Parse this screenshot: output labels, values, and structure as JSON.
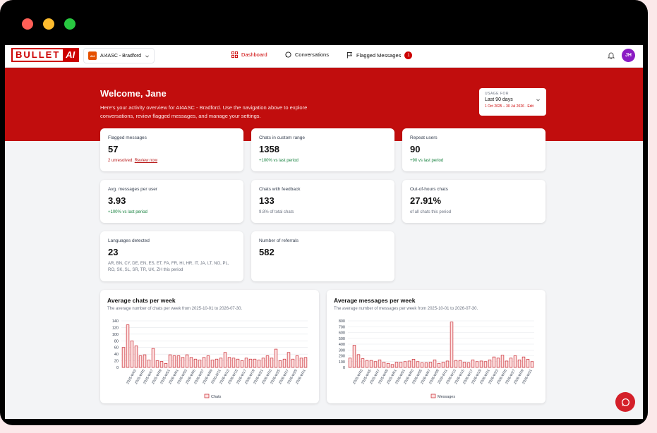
{
  "logo": {
    "part1": "BULLET",
    "part2": "AI"
  },
  "org": {
    "badge": "AI4",
    "name": "AI4ASC - Bradford"
  },
  "nav": {
    "dashboard": "Dashboard",
    "conversations": "Conversations",
    "flagged": "Flagged Messages",
    "flagged_count": "1"
  },
  "user": {
    "initials": "JH"
  },
  "hero": {
    "title": "Welcome, Jane",
    "subtitle": "Here's your activity overview for AI4ASC - Bradford. Use the navigation above to explore conversations, review flagged messages, and manage your settings."
  },
  "usage": {
    "label": "USAGE FOR",
    "value": "Last 90 days",
    "range": "1 Oct 2025 – 30 Jul 2026 · Edit"
  },
  "cards": {
    "flagged": {
      "label": "Flagged messages",
      "value": "57",
      "note_a": "2 unresolved.",
      "note_b": "Review now"
    },
    "chats": {
      "label": "Chats in custom range",
      "value": "1358",
      "note": "+100% vs last period"
    },
    "repeat": {
      "label": "Repeat users",
      "value": "90",
      "note": "+90 vs last period"
    },
    "avg": {
      "label": "Avg. messages per user",
      "value": "3.93",
      "note": "+100% vs last period"
    },
    "feedback": {
      "label": "Chats with feedback",
      "value": "133",
      "note": "9.8% of total chats"
    },
    "ooh": {
      "label": "Out-of-hours chats",
      "value": "27.91%",
      "note": "of all chats this period"
    },
    "languages": {
      "label": "Languages detected",
      "value": "23",
      "note": "AR, BN, CY, DE, EN, ES, ET, FA, FR, HI, HR, IT, JA, LT, NO, PL, RO, SK, SL, SR, TR, UK, ZH this period"
    },
    "referrals": {
      "label": "Number of referrals",
      "value": "582"
    }
  },
  "colors": {
    "brand": "#c10d0d",
    "bar": "#c8242c"
  },
  "chart_data": [
    {
      "type": "bar",
      "title": "Average chats per week",
      "subtitle": "The average number of chats per week from 2025-10-01 to 2026-07-30.",
      "ylim": [
        0,
        140
      ],
      "yticks": [
        0,
        20,
        40,
        60,
        80,
        100,
        120,
        140
      ],
      "categories": [
        "2025-W40",
        "2025-W41",
        "2025-W42",
        "2025-W43",
        "2025-W44",
        "2025-W45",
        "2025-W46",
        "2025-W47",
        "2025-W48",
        "2025-W49",
        "2025-W50",
        "2025-W51",
        "2025-W52",
        "2026-W01",
        "2026-W02",
        "2026-W03",
        "2026-W04",
        "2026-W05",
        "2026-W06",
        "2026-W07",
        "2026-W08",
        "2026-W09",
        "2026-W10",
        "2026-W11",
        "2026-W12",
        "2026-W13",
        "2026-W14",
        "2026-W15",
        "2026-W16",
        "2026-W17",
        "2026-W18",
        "2026-W19",
        "2026-W20",
        "2026-W21",
        "2026-W22",
        "2026-W23",
        "2026-W24",
        "2026-W25",
        "2026-W26",
        "2026-W27",
        "2026-W28",
        "2026-W29",
        "2026-W30",
        "2026-W31"
      ],
      "xtick_labels": [
        "2025-W43",
        "2025-W45",
        "2025-W47",
        "2025-W49",
        "2025-W51",
        "2026-W01",
        "2026-W03",
        "2026-W05",
        "2026-W07",
        "2026-W09",
        "2026-W11",
        "2026-W13",
        "2026-W15",
        "2026-W17",
        "2026-W19",
        "2026-W21",
        "2026-W23",
        "2026-W25",
        "2026-W27",
        "2026-W29",
        "2026-W31"
      ],
      "series": [
        {
          "name": "Chats",
          "values": [
            60,
            128,
            80,
            65,
            35,
            38,
            22,
            57,
            20,
            18,
            12,
            38,
            35,
            35,
            30,
            38,
            30,
            25,
            22,
            30,
            35,
            22,
            25,
            28,
            45,
            30,
            28,
            25,
            20,
            28,
            25,
            25,
            22,
            28,
            35,
            28,
            55,
            20,
            25,
            45,
            25,
            35,
            28,
            30
          ]
        }
      ]
    },
    {
      "type": "bar",
      "title": "Average messages per week",
      "subtitle": "The average number of messages per week from 2025-10-01 to 2026-07-30.",
      "ylim": [
        0,
        800
      ],
      "yticks": [
        0,
        100,
        200,
        300,
        400,
        500,
        600,
        700,
        800
      ],
      "categories": [
        "2025-W40",
        "2025-W41",
        "2025-W42",
        "2025-W43",
        "2025-W44",
        "2025-W45",
        "2025-W46",
        "2025-W47",
        "2025-W48",
        "2025-W49",
        "2025-W50",
        "2025-W51",
        "2025-W52",
        "2026-W01",
        "2026-W02",
        "2026-W03",
        "2026-W04",
        "2026-W05",
        "2026-W06",
        "2026-W07",
        "2026-W08",
        "2026-W09",
        "2026-W10",
        "2026-W11",
        "2026-W12",
        "2026-W13",
        "2026-W14",
        "2026-W15",
        "2026-W16",
        "2026-W17",
        "2026-W18",
        "2026-W19",
        "2026-W20",
        "2026-W21",
        "2026-W22",
        "2026-W23",
        "2026-W24",
        "2026-W25",
        "2026-W26",
        "2026-W27",
        "2026-W28",
        "2026-W29",
        "2026-W30",
        "2026-W31"
      ],
      "xtick_labels": [
        "2025-W43",
        "2025-W45",
        "2025-W47",
        "2025-W49",
        "2025-W51",
        "2026-W01",
        "2026-W03",
        "2026-W05",
        "2026-W07",
        "2026-W09",
        "2026-W11",
        "2026-W13",
        "2026-W15",
        "2026-W17",
        "2026-W19",
        "2026-W21",
        "2026-W23",
        "2026-W25",
        "2026-W27",
        "2026-W29",
        "2026-W31"
      ],
      "series": [
        {
          "name": "Messages",
          "values": [
            160,
            380,
            220,
            150,
            120,
            120,
            100,
            130,
            90,
            70,
            50,
            90,
            90,
            100,
            110,
            140,
            100,
            80,
            80,
            90,
            130,
            70,
            90,
            110,
            780,
            120,
            120,
            90,
            80,
            130,
            100,
            110,
            100,
            130,
            180,
            160,
            210,
            110,
            160,
            200,
            130,
            180,
            140,
            100
          ]
        }
      ]
    }
  ]
}
